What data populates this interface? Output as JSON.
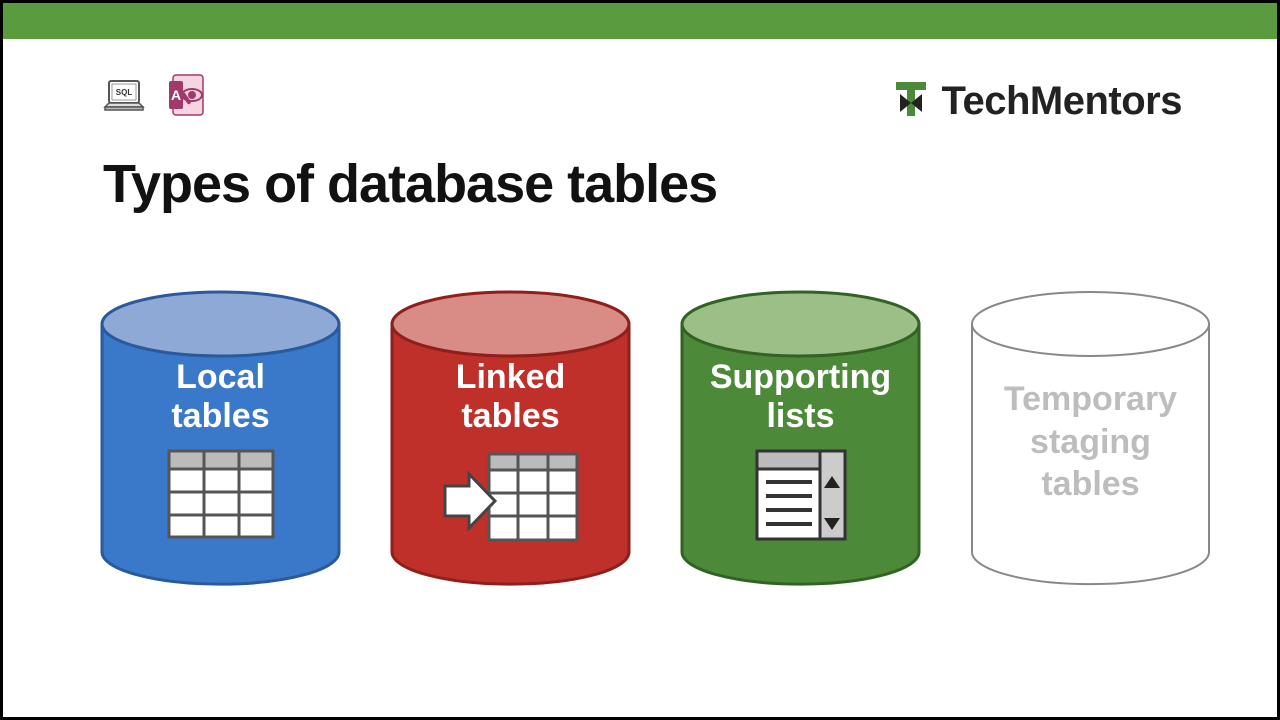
{
  "brand": {
    "name": "TechMentors"
  },
  "title": "Types of database tables",
  "cylinders": [
    {
      "label_line1": "Local",
      "label_line2": "tables",
      "colors": {
        "top": "#8fa9d6",
        "body": "#3a78c9",
        "stroke": "#2b5a9c"
      },
      "icon": "table-grid"
    },
    {
      "label_line1": "Linked",
      "label_line2": "tables",
      "colors": {
        "top": "#d98b85",
        "body": "#c0302b",
        "stroke": "#8e1f1b"
      },
      "icon": "linked-table"
    },
    {
      "label_line1": "Supporting",
      "label_line2": "lists",
      "colors": {
        "top": "#9bbf86",
        "body": "#4c8a3a",
        "stroke": "#336324"
      },
      "icon": "list-box"
    },
    {
      "label_line1": "Temporary",
      "label_line2": "staging",
      "label_line3": "tables",
      "colors": {
        "top": "#ffffff",
        "body": "#ffffff",
        "stroke": "#888888"
      },
      "icon": null,
      "faded": true
    }
  ]
}
